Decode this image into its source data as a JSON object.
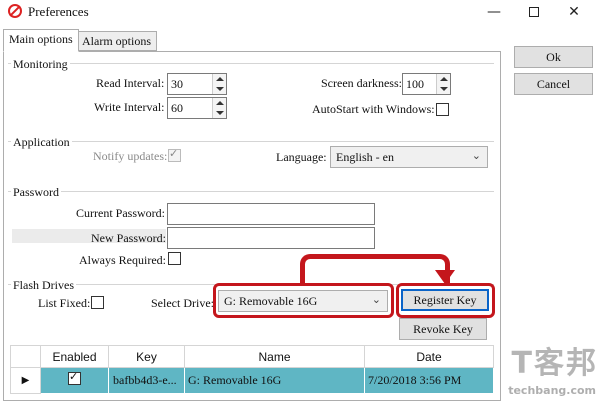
{
  "window": {
    "title": "Preferences",
    "minimize": "—",
    "close": "✕"
  },
  "tabs": [
    {
      "label": "Main options",
      "active": true
    },
    {
      "label": "Alarm options",
      "active": false
    }
  ],
  "side_buttons": {
    "ok": "Ok",
    "cancel": "Cancel"
  },
  "monitoring": {
    "group_label": "Monitoring",
    "read_interval_label": "Read Interval:",
    "read_interval_value": "30",
    "write_interval_label": "Write Interval:",
    "write_interval_value": "60",
    "screen_darkness_label": "Screen darkness:",
    "screen_darkness_value": "100",
    "autostart_label": "AutoStart with Windows:",
    "autostart_checked": false
  },
  "application": {
    "group_label": "Application",
    "notify_updates_label": "Notify updates:",
    "notify_updates_checked": true,
    "notify_updates_enabled": false,
    "language_label": "Language:",
    "language_value": "English - en"
  },
  "password": {
    "group_label": "Password",
    "current_password_label": "Current Password:",
    "current_password_value": "",
    "new_password_label": "New Password:",
    "new_password_value": "",
    "always_required_label": "Always Required:",
    "always_required_checked": false
  },
  "flash_drives": {
    "group_label": "Flash Drives",
    "list_fixed_label": "List Fixed:",
    "list_fixed_checked": false,
    "select_drive_label": "Select Drive:",
    "select_drive_value": "G: Removable 16G",
    "register_key_label": "Register Key",
    "revoke_key_label": "Revoke Key",
    "columns": [
      "Enabled",
      "Key",
      "Name",
      "Date"
    ],
    "rows": [
      {
        "enabled": true,
        "key": "bafbb4d3-e...",
        "name": "G: Removable 16G",
        "date": "7/20/2018 3:56 PM",
        "selected": true
      }
    ]
  },
  "annotation": {
    "color": "#c4161c"
  },
  "watermark": {
    "text": "T客邦",
    "sub": "techbang.com"
  }
}
